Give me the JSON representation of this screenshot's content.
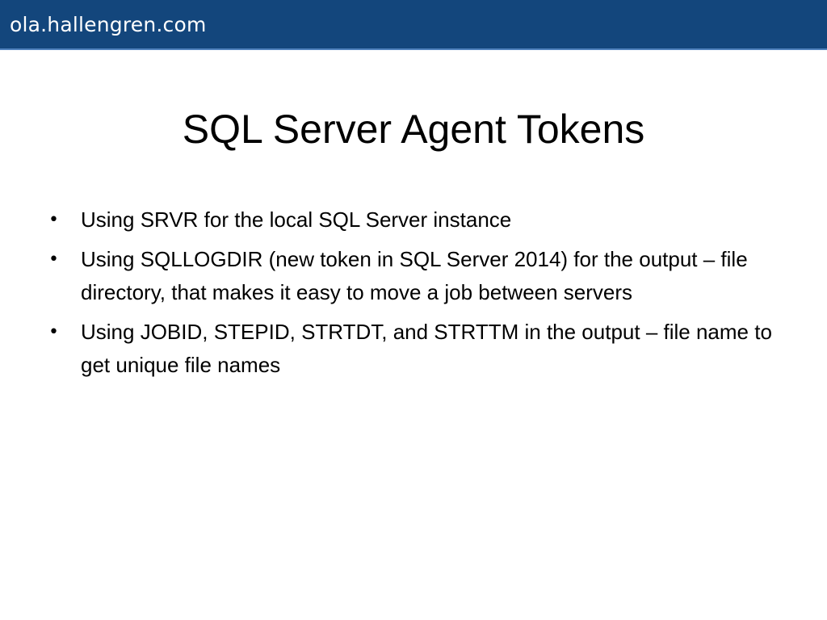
{
  "header": {
    "site_name": "ola.hallengren.com"
  },
  "slide": {
    "title": "SQL Server Agent Tokens",
    "bullets": [
      "Using SRVR for the local SQL Server instance",
      "Using SQLLOGDIR (new token in SQL Server 2014) for the output – file directory, that makes it easy to move a job between servers",
      "Using JOBID, STEPID, STRTDT, and STRTTM in the output – file name to get unique file names"
    ]
  },
  "colors": {
    "header_background": "#13467c",
    "header_accent_line": "#4f81bd",
    "header_text": "#ffffff",
    "body_text": "#000000"
  }
}
